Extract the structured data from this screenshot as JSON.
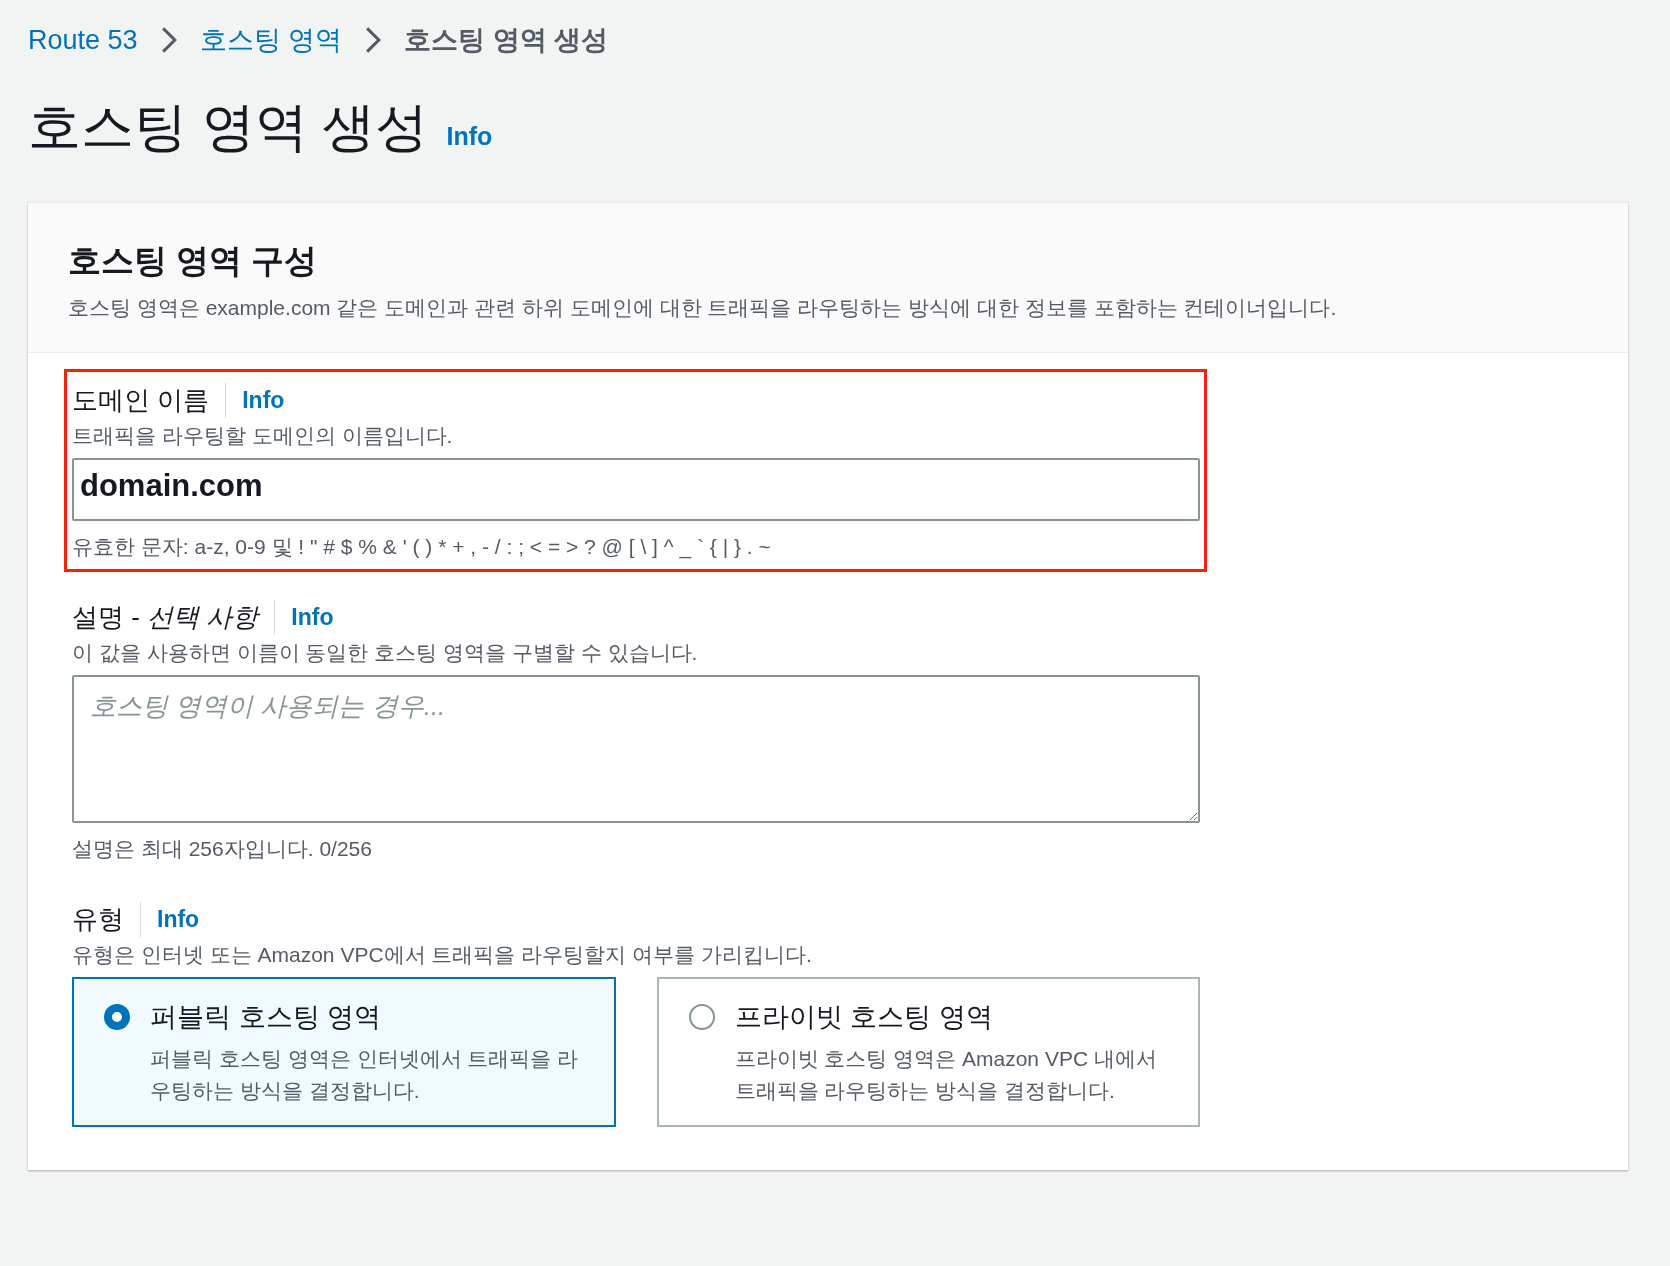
{
  "breadcrumbs": [
    {
      "label": "Route 53",
      "link": true
    },
    {
      "label": "호스팅 영역",
      "link": true
    },
    {
      "label": "호스팅 영역 생성",
      "link": false
    }
  ],
  "page_title": "호스팅 영역 생성",
  "page_info": "Info",
  "panel": {
    "title": "호스팅 영역 구성",
    "description": "호스팅 영역은 example.com 같은 도메인과 관련 하위 도메인에 대한 트래픽을 라우팅하는 방식에 대한 정보를 포함하는 컨테이너입니다.",
    "fields": [
      {
        "kind": "input",
        "label": "도메인 이름",
        "info": "Info",
        "description": "트래픽을 라우팅할 도메인의 이름입니다.",
        "value": "domain.com",
        "constraint": "유효한 문자: a-z, 0-9 및 ! \" # $ % & ' ( ) * + , - / : ; < = > ? @ [ \\ ] ^ _ ` { | } . ~",
        "highlighted": true
      },
      {
        "kind": "textarea",
        "label": "설명 - *선택 사항*",
        "info": "Info",
        "description": "이 값을 사용하면 이름이 동일한 호스팅 영역을 구별할 수 있습니다.",
        "placeholder": "호스팅 영역이 사용되는 경우...",
        "constraint": "설명은 최대 256자입니다. 0/256"
      },
      {
        "kind": "tiles",
        "label": "유형",
        "info": "Info",
        "description": "유형은 인터넷 또는 Amazon VPC에서 트래픽을 라우팅할지 여부를 가리킵니다.",
        "options": [
          {
            "title": "퍼블릭 호스팅 영역",
            "description": "퍼블릭 호스팅 영역은 인터넷에서 트래픽을 라우팅하는 방식을 결정합니다.",
            "selected": true
          },
          {
            "title": "프라이빗 호스팅 영역",
            "description": "프라이빗 호스팅 영역은 Amazon VPC 내에서 트래픽을 라우팅하는 방식을 결정합니다.",
            "selected": false
          }
        ]
      }
    ]
  }
}
